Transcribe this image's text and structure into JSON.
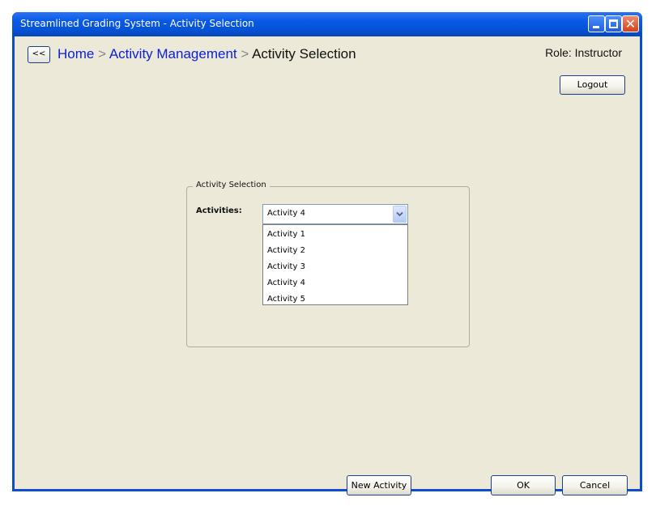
{
  "window": {
    "title": "Streamlined Grading System - Activity Selection",
    "minimize_icon": "minimize-icon",
    "maximize_icon": "maximize-icon",
    "close_icon": "close-icon",
    "close_glyph": "✕"
  },
  "nav": {
    "back_label": "<<",
    "breadcrumb": [
      {
        "label": "Home",
        "link": true
      },
      {
        "label": "Activity Management",
        "link": true
      },
      {
        "label": "Activity Selection",
        "link": false
      }
    ],
    "separator": ">"
  },
  "user": {
    "role_text": "Role: Instructor",
    "logout_label": "Logout"
  },
  "activity_panel": {
    "legend": "Activity Selection",
    "activities_label": "Activities:",
    "selected_value": "Activity 4",
    "dropdown_arrow_icon": "chevron-down-icon",
    "options": [
      "Activity 1",
      "Activity 2",
      "Activity 3",
      "Activity 4",
      "Activity 5"
    ]
  },
  "footer": {
    "new_activity_label": "New Activity",
    "ok_label": "OK",
    "cancel_label": "Cancel"
  },
  "colors": {
    "titlebar_blue": "#0a5ae8",
    "window_face": "#ece9d8",
    "link_blue": "#0b1fd4"
  }
}
